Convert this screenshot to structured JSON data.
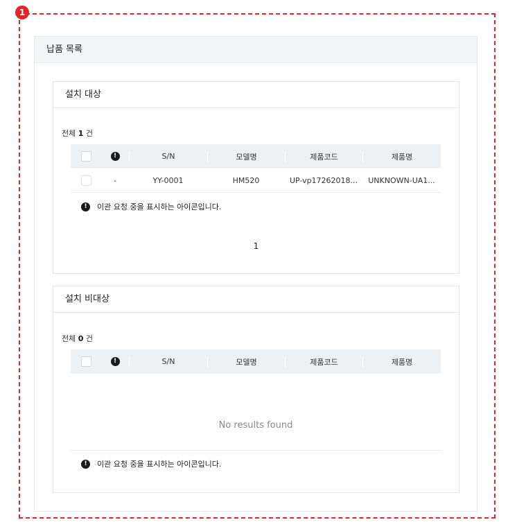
{
  "annotation": {
    "marker": "1"
  },
  "panel": {
    "title": "납품 목록"
  },
  "install_target": {
    "title": "설치 대상",
    "count_prefix": "전체",
    "count": "1",
    "count_suffix": "건",
    "columns": [
      "S/N",
      "모델명",
      "제품코드",
      "제품명"
    ],
    "rows": [
      {
        "status": "-",
        "sn": "YY-0001",
        "model": "HM520",
        "code": "UP-vp17262018...",
        "name": "UNKNOWN-UA1..."
      }
    ],
    "note": "이관 요청 중을 표시하는 아이콘입니다.",
    "page": "1"
  },
  "install_non_target": {
    "title": "설치 비대상",
    "count_prefix": "전체",
    "count": "0",
    "count_suffix": "건",
    "columns": [
      "S/N",
      "모델명",
      "제품코드",
      "제품명"
    ],
    "empty_text": "No results found",
    "note": "이관 요청 중을 표시하는 아이콘입니다."
  },
  "icons": {
    "header_status": "exclamation-circle-icon",
    "note": "exclamation-circle-icon"
  },
  "colors": {
    "annotation": "#e0262a",
    "table_header_bg": "#eef1f4",
    "panel_header_bg": "#f4f5f6"
  }
}
